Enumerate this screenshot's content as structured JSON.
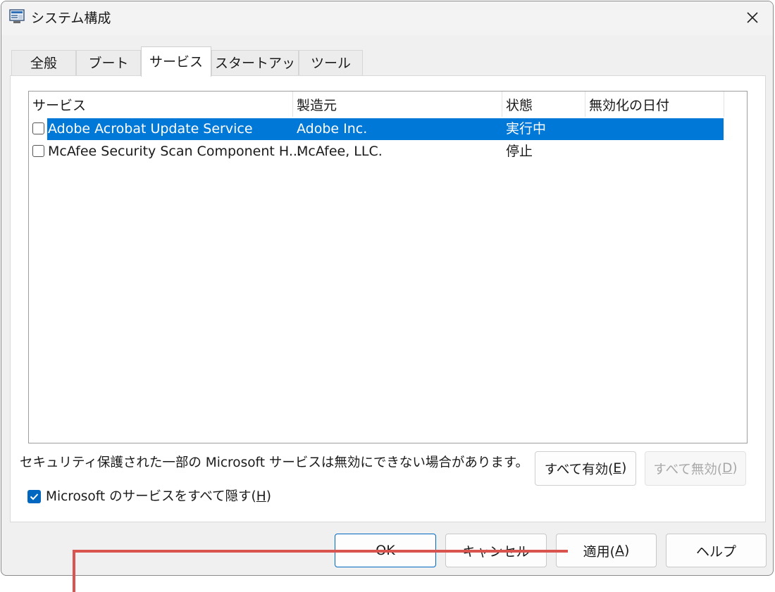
{
  "window": {
    "title": "システム構成"
  },
  "tabs": [
    {
      "label": "全般"
    },
    {
      "label": "ブート"
    },
    {
      "label": "サービス"
    },
    {
      "label": "スタートアップ"
    },
    {
      "label": "ツール"
    }
  ],
  "active_tab": "サービス",
  "list": {
    "columns": [
      "サービス",
      "製造元",
      "状態",
      "無効化の日付"
    ],
    "rows": [
      {
        "service": "Adobe Acrobat Update Service",
        "maker": "Adobe Inc.",
        "status": "実行中",
        "disabled_date": "",
        "checked": false,
        "selected": true
      },
      {
        "service": "McAfee Security Scan Component H...",
        "maker": "McAfee, LLC.",
        "status": "停止",
        "disabled_date": "",
        "checked": false,
        "selected": false
      }
    ]
  },
  "notice": "セキュリティ保護された一部の Microsoft サービスは無効にできない場合があります。",
  "enable_all": {
    "label": "すべて有効(",
    "key": "E",
    "suffix": ")"
  },
  "disable_all": {
    "label": "すべて無効(",
    "key": "D",
    "suffix": ")"
  },
  "hide_ms": {
    "label": "Microsoft のサービスをすべて隠す(",
    "key": "H",
    "suffix": ")",
    "checked": true
  },
  "buttons": {
    "ok": "OK",
    "cancel": "キャンセル",
    "apply": {
      "label": "適用(",
      "key": "A",
      "suffix": ")"
    },
    "help": "ヘルプ"
  },
  "colors": {
    "selection": "#0078d7",
    "checkbox_checked": "#0067c0",
    "annotation_line": "#d9534f"
  }
}
